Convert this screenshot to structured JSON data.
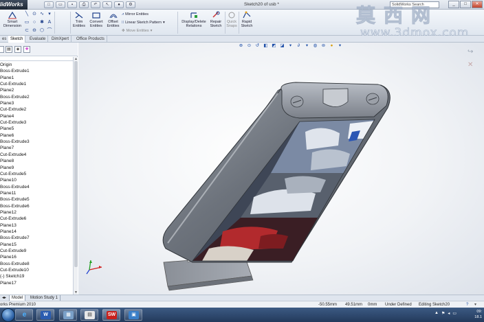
{
  "app": {
    "logo_text": "lidWorks",
    "document_title": "Sketch20 of usb *",
    "search_placeholder": "SolidWorks Search",
    "window_buttons": [
      "_",
      "□",
      "✕"
    ]
  },
  "ribbon": {
    "smart_dimension": "Smart Dimension",
    "trim_entities": "Trim Entities",
    "convert_entities": "Convert Entities",
    "offset_entities": "Offset Entities",
    "mirror_entities": "Mirror Entities",
    "linear_sketch_pattern": "Linear Sketch Pattern",
    "move_entities": "Move Entities",
    "display_delete_relations": "Display/Delete Relations",
    "repair_sketch": "Repair Sketch",
    "quick_snaps": "Quick Snaps",
    "rapid_sketch": "Rapid Sketch"
  },
  "tabs": {
    "items": [
      "es",
      "Sketch",
      "Evaluate",
      "DimXpert",
      "Office Products"
    ],
    "active": "Sketch"
  },
  "feature_tree": {
    "items": [
      "Origin",
      "Boss-Extrude1",
      "Plane1",
      "Cut-Extrude1",
      "Plane2",
      "Boss-Extrude2",
      "Plane3",
      "Cut-Extrude2",
      "Plane4",
      "Cut-Extrude3",
      "Plane5",
      "Plane6",
      "Boss-Extrude3",
      "Plane7",
      "Cut-Extrude4",
      "Plane8",
      "Plane9",
      "Cut-Extrude5",
      "Plane10",
      "Boss-Extrude4",
      "Plane11",
      "Boss-Extrude5",
      "Boss-Extrude6",
      "Plane12",
      "Cut-Extrude6",
      "Plane13",
      "Plane14",
      "Boss-Extrude7",
      "Plane15",
      "Cut-Extrude9",
      "Plane16",
      "Boss-Extrude8",
      "Cut-Extrude10",
      "(-) Sketch19",
      "Plane17"
    ]
  },
  "bottom_tabs": {
    "items": [
      "Model",
      "Motion Study 1"
    ],
    "active": "Model"
  },
  "status": {
    "product": "orks Premium 2010",
    "x": "-50.55mm",
    "y": "49.51mm",
    "z": "0mm",
    "state": "Under Defined",
    "mode": "Editing Sketch20"
  },
  "taskbar": {
    "clock_time": "09:",
    "clock_date": "18.1"
  },
  "watermark": {
    "chinese": "莫西网",
    "url": "www.3dmox.com"
  },
  "colors": {
    "ribbon_icon_blue": "#1d3f8a",
    "model_body": "#6f747c",
    "taskbar": "#2c4669"
  }
}
